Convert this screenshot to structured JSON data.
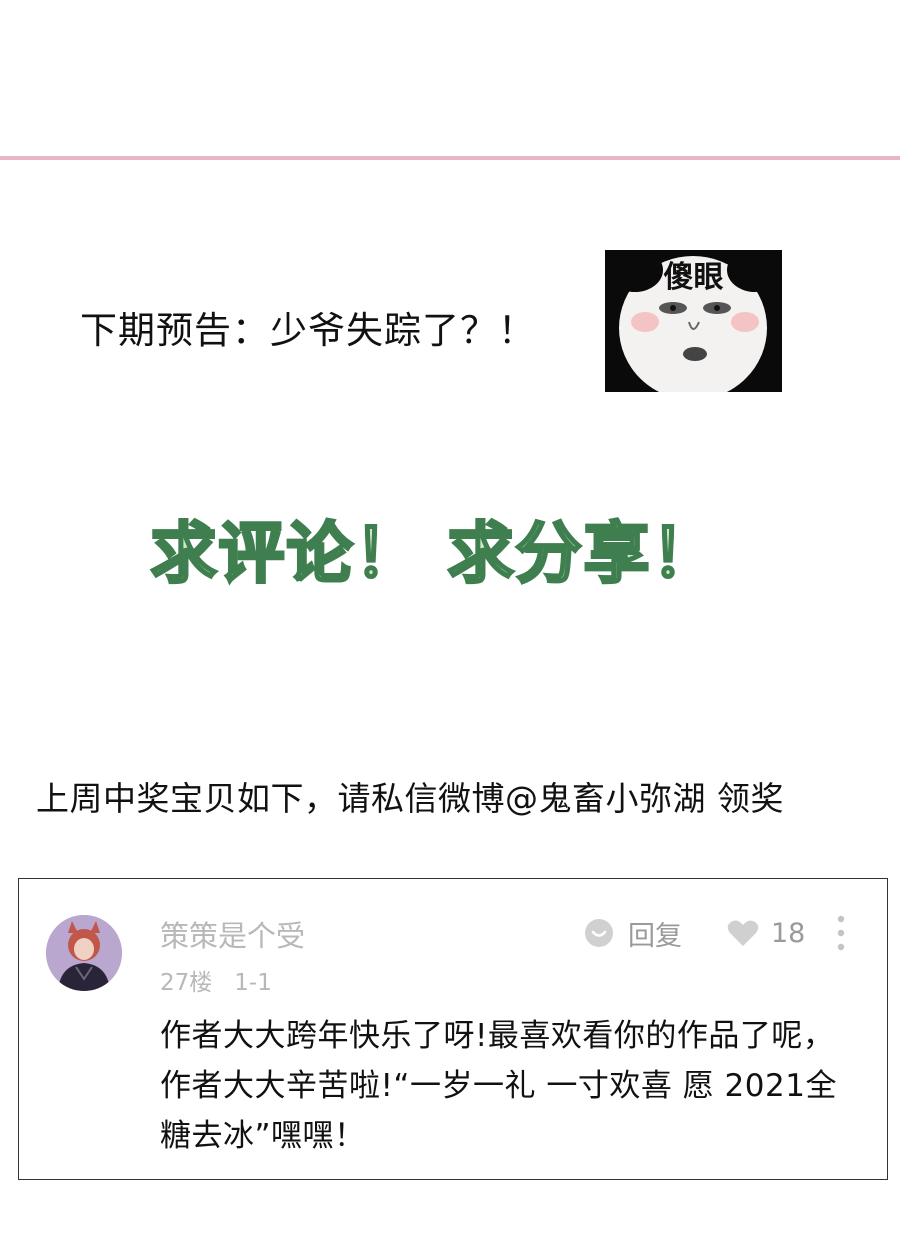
{
  "header": {
    "divider_color": "#e8b4c8"
  },
  "preview": {
    "text": "下期预告：少爷失踪了？！",
    "meme": {
      "caption": "傻眼",
      "icon": "panda-meme-face"
    }
  },
  "cta": {
    "text": "求评论！ 求分享！",
    "fill_color": "#cfe9c6",
    "stroke_color": "#3f7f4f"
  },
  "winners": {
    "text": "上周中奖宝贝如下，请私信微博@鬼畜小弥湖 领奖"
  },
  "comment": {
    "username": "策策是个受",
    "floor": "27楼",
    "date": "1-1",
    "reply_label": "回复",
    "like_count": "18",
    "body": "作者大大跨年快乐了呀!最喜欢看你的作品了呢，作者大大辛苦啦!“一岁一礼 一寸欢喜 愿 2021全糖去冰”嘿嘿！",
    "icons": {
      "reply": "reply-bubble-icon",
      "like": "heart-icon",
      "more": "more-vertical-icon",
      "avatar": "avatar"
    }
  }
}
